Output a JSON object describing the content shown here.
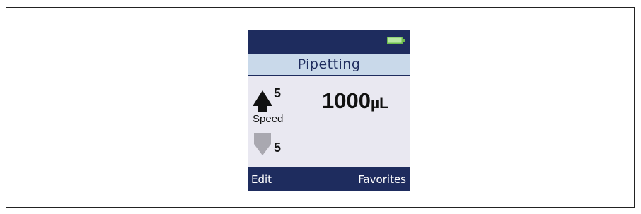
{
  "screen": {
    "title": "Pipetting",
    "battery_icon": "battery-full-icon"
  },
  "settings": {
    "aspirate_speed": "5",
    "dispense_speed": "5",
    "speed_label": "Speed",
    "volume_value": "1000",
    "volume_unit": "µL",
    "aspirate_icon": "arrow-up-icon",
    "dispense_icon": "arrow-down-icon"
  },
  "softkeys": {
    "left_label": "Edit",
    "right_label": "Favorites"
  },
  "colors": {
    "bar_navy": "#1e2c5e",
    "title_bg": "#c9d9ea",
    "content_bg": "#e9e8f1",
    "battery_green": "#6fbf4f"
  }
}
